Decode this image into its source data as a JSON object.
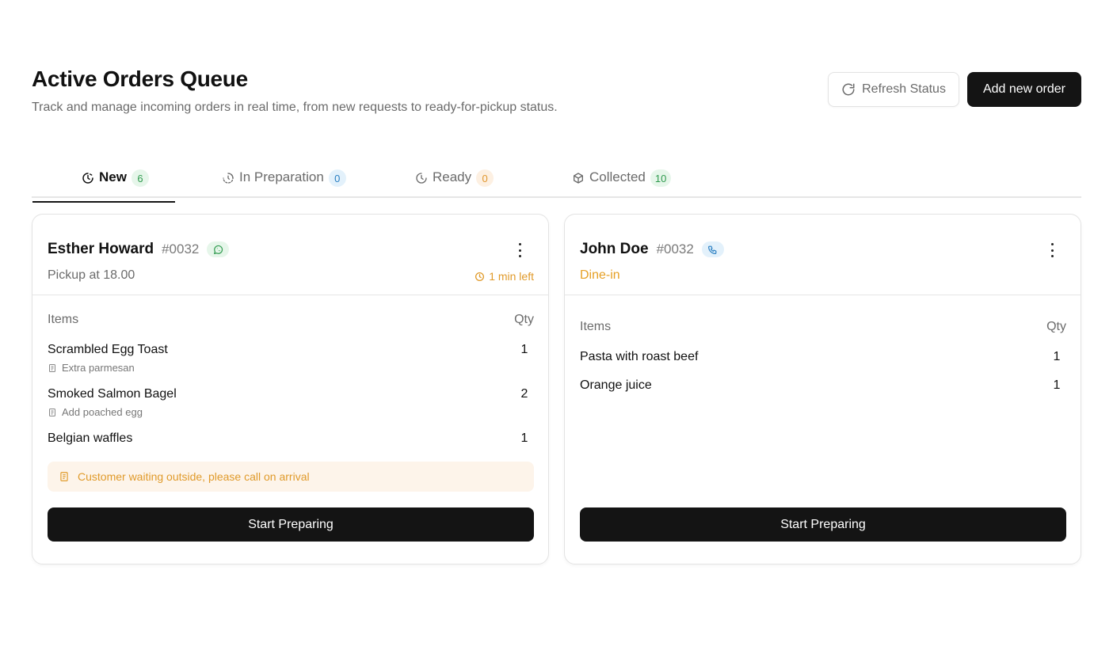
{
  "header": {
    "title": "Active Orders Queue",
    "subtitle": "Track and manage incoming orders in real time, from new requests to ready-for-pickup status.",
    "refresh_label": "Refresh Status",
    "add_label": "Add new order"
  },
  "tabs": [
    {
      "label": "New",
      "count": "6",
      "icon": "clock-icon",
      "active": true
    },
    {
      "label": "In Preparation",
      "count": "0",
      "icon": "timer-icon",
      "active": false
    },
    {
      "label": "Ready",
      "count": "0",
      "icon": "clock-check-icon",
      "active": false
    },
    {
      "label": "Collected",
      "count": "10",
      "icon": "package-icon",
      "active": false
    }
  ],
  "orders": [
    {
      "customer": "Esther Howard",
      "order_id": "#0032",
      "channel_icon": "whatsapp-icon",
      "subline": "Pickup at 18.00",
      "time_left": "1 min left",
      "items_header": "Items",
      "qty_header": "Qty",
      "items": [
        {
          "name": "Scrambled Egg Toast",
          "qty": "1",
          "note": "Extra parmesan"
        },
        {
          "name": "Smoked Salmon Bagel",
          "qty": "2",
          "note": "Add poached egg"
        },
        {
          "name": "Belgian waffles",
          "qty": "1",
          "note": ""
        }
      ],
      "order_note": "Customer waiting outside, please call on arrival",
      "action_label": "Start Preparing"
    },
    {
      "customer": "John Doe",
      "order_id": "#0032",
      "channel_icon": "phone-icon",
      "subline": "Dine-in",
      "items_header": "Items",
      "qty_header": "Qty",
      "items": [
        {
          "name": "Pasta with roast beef",
          "qty": "1"
        },
        {
          "name": "Orange juice",
          "qty": "1"
        }
      ],
      "action_label": "Start Preparing"
    }
  ],
  "colors": {
    "accent_dark": "#141414",
    "green_badge": "#2f9a4e",
    "blue_badge": "#2a7fc2",
    "orange_warning": "#e09a2a"
  }
}
